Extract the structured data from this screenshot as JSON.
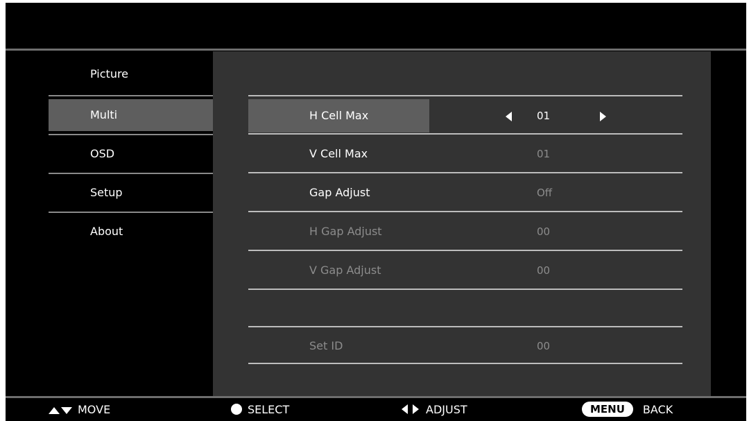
{
  "sidebar": {
    "items": [
      {
        "label": "Picture"
      },
      {
        "label": "Multi"
      },
      {
        "label": "OSD"
      },
      {
        "label": "Setup"
      },
      {
        "label": "About"
      }
    ],
    "active_index": 1
  },
  "settings": {
    "rows": [
      {
        "label": "H Cell Max",
        "value": "01"
      },
      {
        "label": "V Cell Max",
        "value": "01"
      },
      {
        "label": "Gap Adjust",
        "value": "Off"
      },
      {
        "label": "H Gap Adjust",
        "value": "00"
      },
      {
        "label": "V Gap Adjust",
        "value": "00"
      },
      {
        "label": "Set ID",
        "value": "00"
      }
    ]
  },
  "footer": {
    "move": "MOVE",
    "select": "SELECT",
    "adjust": "ADJUST",
    "menu_key": "MENU",
    "back": "BACK"
  },
  "icons": {
    "move": "up-down-triangles-icon",
    "select": "filled-circle-icon",
    "adjust": "left-right-triangles-icon",
    "value_left": "left-arrow-icon",
    "value_right": "right-arrow-icon"
  },
  "colors": {
    "background": "#000000",
    "panel": "#333333",
    "selected": "#5e5e5e",
    "disabled_text": "#8c8c8c"
  }
}
